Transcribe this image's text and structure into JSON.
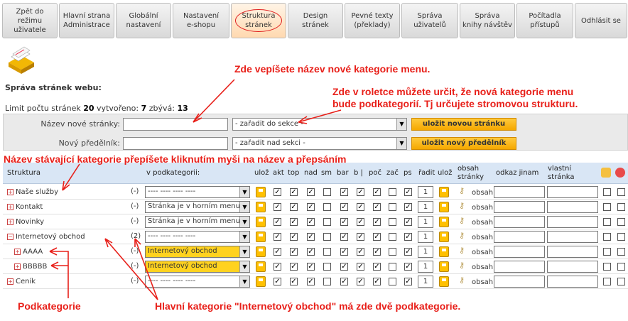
{
  "nav": {
    "tabs": [
      {
        "label": "Zpět do režimu\nuživatele"
      },
      {
        "label": "Hlavní strana\nAdministrace"
      },
      {
        "label": "Globální\nnastavení"
      },
      {
        "label": "Nastavení\ne-shopu"
      },
      {
        "label": "Struktura\nstránek"
      },
      {
        "label": "Design\nstránek"
      },
      {
        "label": "Pevné texty\n(překlady)"
      },
      {
        "label": "Správa\nuživatelů"
      },
      {
        "label": "Správa\nknihy návštěv"
      },
      {
        "label": "Počítadla\npřístupů"
      },
      {
        "label": "Odhlásit se"
      }
    ]
  },
  "page": {
    "title": "Správa stránek webu:",
    "limit_label": "Limit počtu stránek",
    "limit_value": "20",
    "created_label": "vytvořeno:",
    "created_value": "7",
    "remaining_label": "zbývá:",
    "remaining_value": "13"
  },
  "form": {
    "page_label": "Název nové stránky:",
    "page_value": "",
    "page_section": "- zařadit do sekce -",
    "page_button": "uložit novou stránku",
    "divider_label": "Nový předělník:",
    "divider_value": "",
    "divider_section": "- zařadit nad sekci -",
    "divider_button": "uložit nový předělník"
  },
  "annotations": {
    "a1": "Zde  vepíšete  název nové kategorie menu.",
    "a2": "Zde v roletce můžete určit, že nová kategorie menu",
    "a3": "bude podkategorií. Tj určujete stromovou strukturu.",
    "a4": "Název stávající kategorie přepíšete kliknutím myši na název a přepsáním",
    "a5": "Podkategorie",
    "a6": "Hlavní kategorie \"Internetový obchod\" má zde dvě podkategorie."
  },
  "table": {
    "headers": {
      "struktura": "Struktura",
      "podkategorii": "v podkategorii:",
      "uloz": "ulož",
      "akt": "akt",
      "top": "top",
      "nad": "nad",
      "sm": "sm",
      "bar": "bar",
      "b": "b |",
      "poc": "poč",
      "zac": "zač",
      "ps": "ps",
      "radit": "řadit",
      "uloz2": "ulož",
      "obsah": "obsah\nstránky",
      "odkaz": "odkaz jinam",
      "vlastni": "vlastní\nstránka"
    },
    "rows": [
      {
        "name": "Naše služby",
        "sign": "+",
        "count": "(-)",
        "parent": "---- ---- ---- ----",
        "hl": false,
        "checks": [
          1,
          1,
          1,
          0,
          1,
          1,
          1,
          0,
          1
        ],
        "order": "1",
        "obsah": "obsah"
      },
      {
        "name": "Kontakt",
        "sign": "+",
        "count": "(-)",
        "parent": "Stránka je v horním menu",
        "hl": false,
        "checks": [
          1,
          1,
          1,
          0,
          1,
          1,
          1,
          0,
          1
        ],
        "order": "1",
        "obsah": "obsah"
      },
      {
        "name": "Novinky",
        "sign": "+",
        "count": "(-)",
        "parent": "Stránka je v horním menu",
        "hl": false,
        "checks": [
          1,
          1,
          1,
          0,
          1,
          1,
          1,
          0,
          1
        ],
        "order": "1",
        "obsah": "obsah"
      },
      {
        "name": "Internetový obchod",
        "sign": "−",
        "count": "(2)",
        "parent": "---- ---- ---- ----",
        "hl": false,
        "checks": [
          1,
          1,
          1,
          0,
          1,
          1,
          1,
          0,
          1
        ],
        "order": "1",
        "obsah": "obsah"
      },
      {
        "name": "AAAA",
        "sign": "+",
        "count": "(-)",
        "parent": "Internetový obchod",
        "hl": true,
        "checks": [
          1,
          1,
          1,
          0,
          1,
          1,
          1,
          0,
          1
        ],
        "order": "1",
        "obsah": "obsah"
      },
      {
        "name": "BBBBB",
        "sign": "+",
        "count": "(-)",
        "parent": "Internetový obchod",
        "hl": true,
        "checks": [
          1,
          1,
          1,
          0,
          1,
          1,
          1,
          0,
          1
        ],
        "order": "1",
        "obsah": "obsah"
      },
      {
        "name": "Ceník",
        "sign": "+",
        "count": "(-)",
        "parent": "---- ---- ---- ----",
        "hl": false,
        "checks": [
          1,
          1,
          1,
          0,
          1,
          1,
          1,
          0,
          1
        ],
        "order": "1",
        "obsah": "obsah"
      }
    ]
  },
  "colors": {
    "accent": "#e8201a",
    "orange": "#f5a800",
    "header": "#d9e6f5"
  }
}
